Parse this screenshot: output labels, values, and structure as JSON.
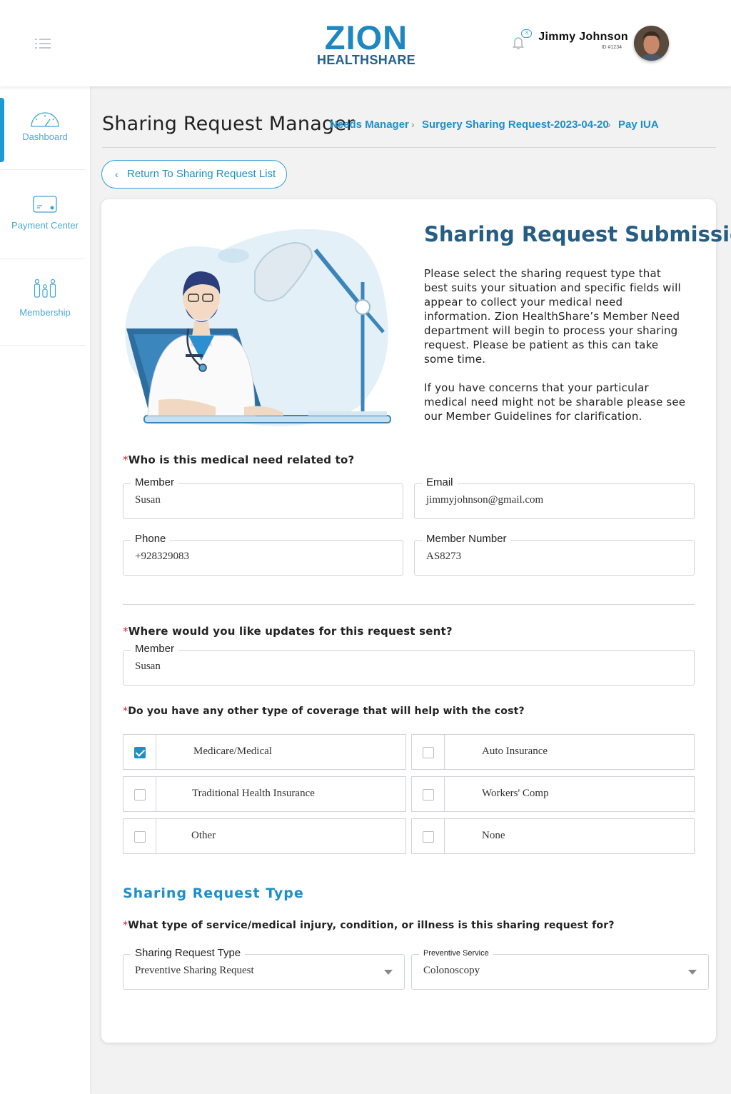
{
  "header": {
    "logo_top": "ZION",
    "logo_bottom": "HEALTHSHARE",
    "notification_count": "3",
    "user_name": "Jimmy Johnson",
    "user_id": "ID #1234"
  },
  "sidebar": {
    "items": [
      {
        "label": "Dashboard",
        "icon": "gauge-icon",
        "active": true
      },
      {
        "label": "Payment Center",
        "icon": "card-icon",
        "active": false
      },
      {
        "label": "Membership",
        "icon": "family-icon",
        "active": false
      }
    ]
  },
  "page": {
    "title": "Sharing Request Manager",
    "breadcrumb": [
      "Needs Manager",
      "Surgery Sharing Request-2023-04-20",
      "Pay IUA"
    ],
    "return_label": "Return To Sharing Request List"
  },
  "submission": {
    "title": "Sharing Request Submission",
    "paragraph1": "Please select the sharing request type that best suits your situation and specific fields will appear to collect your medical need information. Zion HealthShare’s Member Need department will begin to process your sharing request. Please be patient as this can take some time.",
    "paragraph2": "If you have concerns that your particular medical need might not be sharable please see our Member Guidelines for clarification."
  },
  "related": {
    "question": "Who is this medical need related to?",
    "member_label": "Member",
    "member_value": "Susan",
    "email_label": "Email",
    "email_value": "jimmyjohnson@gmail.com",
    "phone_label": "Phone",
    "phone_value": "+928329083",
    "member_number_label": "Member Number",
    "member_number_value": "AS8273"
  },
  "updates": {
    "question": "Where would you like updates for this request sent?",
    "member_label": "Member",
    "member_value": "Susan"
  },
  "coverage": {
    "question": "Do you have any other type of coverage that will help with the cost?",
    "options": [
      {
        "label": "Medicare/Medical",
        "checked": true
      },
      {
        "label": "Auto Insurance",
        "checked": false
      },
      {
        "label": "Traditional Health Insurance",
        "checked": false
      },
      {
        "label": "Workers' Comp",
        "checked": false
      },
      {
        "label": "Other",
        "checked": false
      },
      {
        "label": "None",
        "checked": false
      }
    ]
  },
  "request_type": {
    "section_title": "Sharing Request Type",
    "question": "What type of service/medical injury, condition, or illness is this sharing request for?",
    "type_label": "Sharing Request Type",
    "type_value": "Preventive Sharing Request",
    "service_label": "Preventive Service",
    "service_value": "Colonoscopy"
  },
  "colors": {
    "accent": "#1f8fc6",
    "title_dark": "#255d85",
    "required": "#d9202a"
  }
}
